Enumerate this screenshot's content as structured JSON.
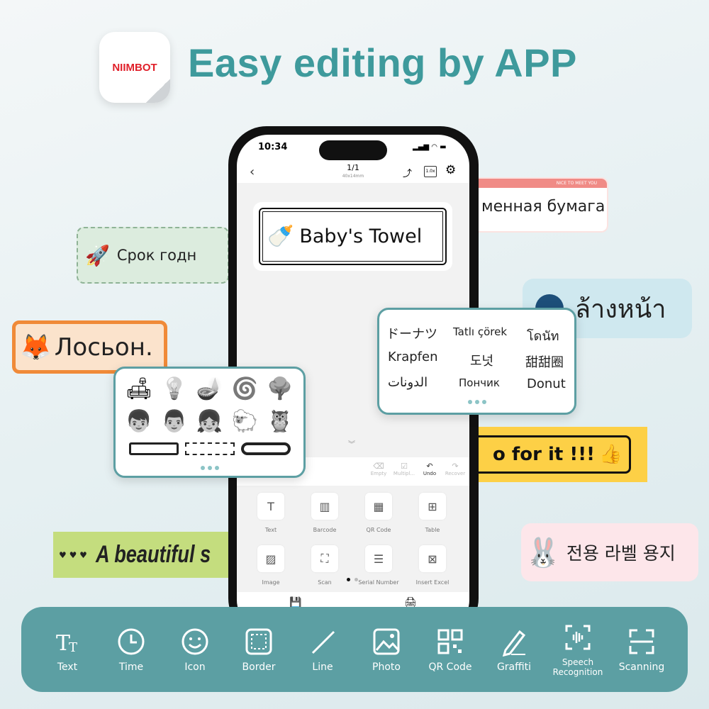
{
  "brand": {
    "logo_text": "NIIMBOT",
    "title": "Easy editing by APP",
    "accent": "#3e9a9c",
    "bar_color": "#5c9fa3"
  },
  "labels": {
    "russian_paper": {
      "banner": "NICE TO MEET YOU",
      "text": "менная бумага"
    },
    "rocket": {
      "text": "Срок годн"
    },
    "thai": {
      "text": "ล้างหน้า"
    },
    "fox": {
      "text": "Лосьон."
    },
    "go": {
      "text": "o for it !!!"
    },
    "beautiful": {
      "prefix": "♥ ♥ ♥",
      "text": "A beautiful s"
    },
    "korean": {
      "text": "전용 라벨 용지"
    }
  },
  "phone": {
    "time": "10:34",
    "page": "1/1",
    "size": "40x14mm",
    "label_text": "Baby's Towel",
    "toolbar": [
      "Empty",
      "Multipl...",
      "Undo",
      "Recover"
    ],
    "tools": [
      {
        "label": "Text",
        "icon": "text-icon"
      },
      {
        "label": "Barcode",
        "icon": "barcode-icon"
      },
      {
        "label": "QR Code",
        "icon": "qr-icon"
      },
      {
        "label": "Table",
        "icon": "table-icon"
      },
      {
        "label": "Image",
        "icon": "image-icon"
      },
      {
        "label": "Scan",
        "icon": "scan-icon"
      },
      {
        "label": "Serial Number",
        "icon": "serial-icon"
      },
      {
        "label": "Insert Excel",
        "icon": "excel-icon"
      }
    ]
  },
  "languages": [
    "ドーナツ",
    "Tatlı çörek",
    "โดนัท",
    "Krapfen",
    "도넛",
    "甜甜圈",
    "الدونات",
    "Пончик",
    "Donut"
  ],
  "bottom_bar": [
    {
      "label": "Text",
      "icon": "text-size-icon"
    },
    {
      "label": "Time",
      "icon": "clock-icon"
    },
    {
      "label": "Icon",
      "icon": "smiley-icon"
    },
    {
      "label": "Border",
      "icon": "border-icon"
    },
    {
      "label": "Line",
      "icon": "line-icon"
    },
    {
      "label": "Photo",
      "icon": "photo-icon"
    },
    {
      "label": "QR Code",
      "icon": "qr-code-icon"
    },
    {
      "label": "Graffiti",
      "icon": "pen-icon"
    },
    {
      "label": "Speech Recognition",
      "icon": "speech-icon"
    },
    {
      "label": "Scanning",
      "icon": "scan-icon"
    }
  ]
}
